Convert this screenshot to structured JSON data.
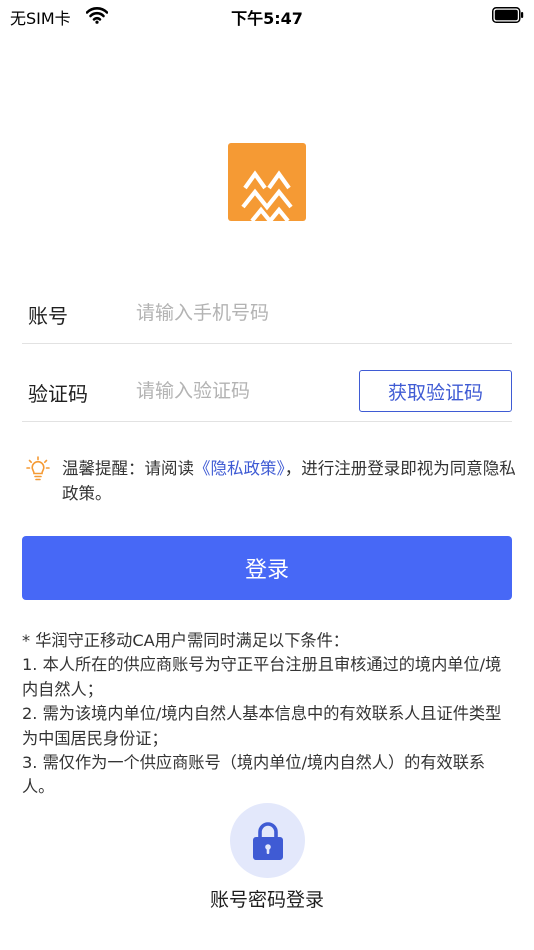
{
  "status_bar": {
    "carrier": "无SIM卡",
    "time": "下午5:47"
  },
  "icons": {
    "wifi": "wifi-icon",
    "battery": "battery-icon",
    "logo": "app-logo",
    "tip": "lightbulb-icon",
    "lock": "lock-icon"
  },
  "colors": {
    "brand_orange": "#f59a34",
    "accent_blue": "#4768f6",
    "link_blue": "#3f5bd4",
    "lock_circle_bg": "#e3e8fb"
  },
  "form": {
    "account": {
      "label": "账号",
      "placeholder": "请输入手机号码"
    },
    "code": {
      "label": "验证码",
      "placeholder": "请输入验证码",
      "get_code_label": "获取验证码"
    }
  },
  "tip": {
    "prefix": "温馨提醒：请阅读",
    "link": "《隐私政策》",
    "suffix": "，进行注册登录即视为同意隐私政策。"
  },
  "login_button": "登录",
  "notes": [
    "* 华润守正移动CA用户需同时满足以下条件：",
    "1. 本人所在的供应商账号为守正平台注册且审核通过的境内单位/境内自然人；",
    "2. 需为该境内单位/境内自然人基本信息中的有效联系人且证件类型为中国居民身份证；",
    "3. 需仅作为一个供应商账号（境内单位/境内自然人）的有效联系人。"
  ],
  "password_login": {
    "label": "账号密码登录"
  }
}
